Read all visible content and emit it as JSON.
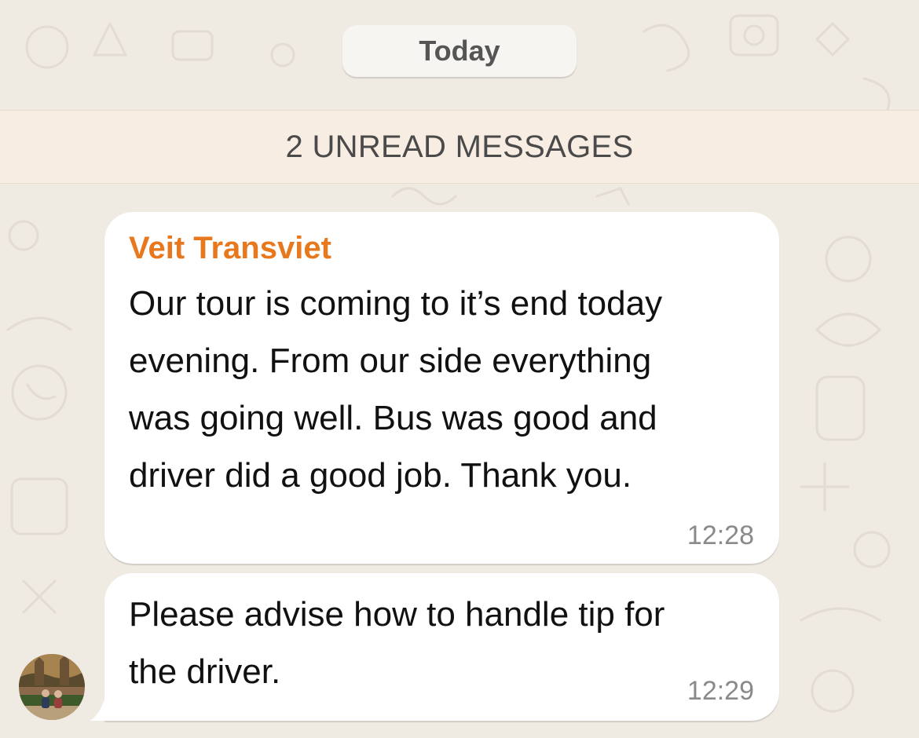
{
  "chat": {
    "date_separator": "Today",
    "unread_banner": "2 UNREAD MESSAGES",
    "messages": [
      {
        "sender": "Veit Transviet",
        "lines": [
          "Our tour is coming to it’s end today",
          "evening. From our side everything",
          "was going well. Bus was good and",
          "driver did a good job. Thank you."
        ],
        "time": "12:28"
      },
      {
        "lines": [
          "Please advise how to handle tip for",
          "the driver."
        ],
        "time": "12:29"
      }
    ]
  },
  "colors": {
    "wallpaper": "#efeae2",
    "unread_banner_bg": "#f8ede2",
    "sender_name": "#e8781e",
    "bubble": "#ffffff"
  },
  "icons": {
    "avatar": "contact-avatar-photo"
  }
}
